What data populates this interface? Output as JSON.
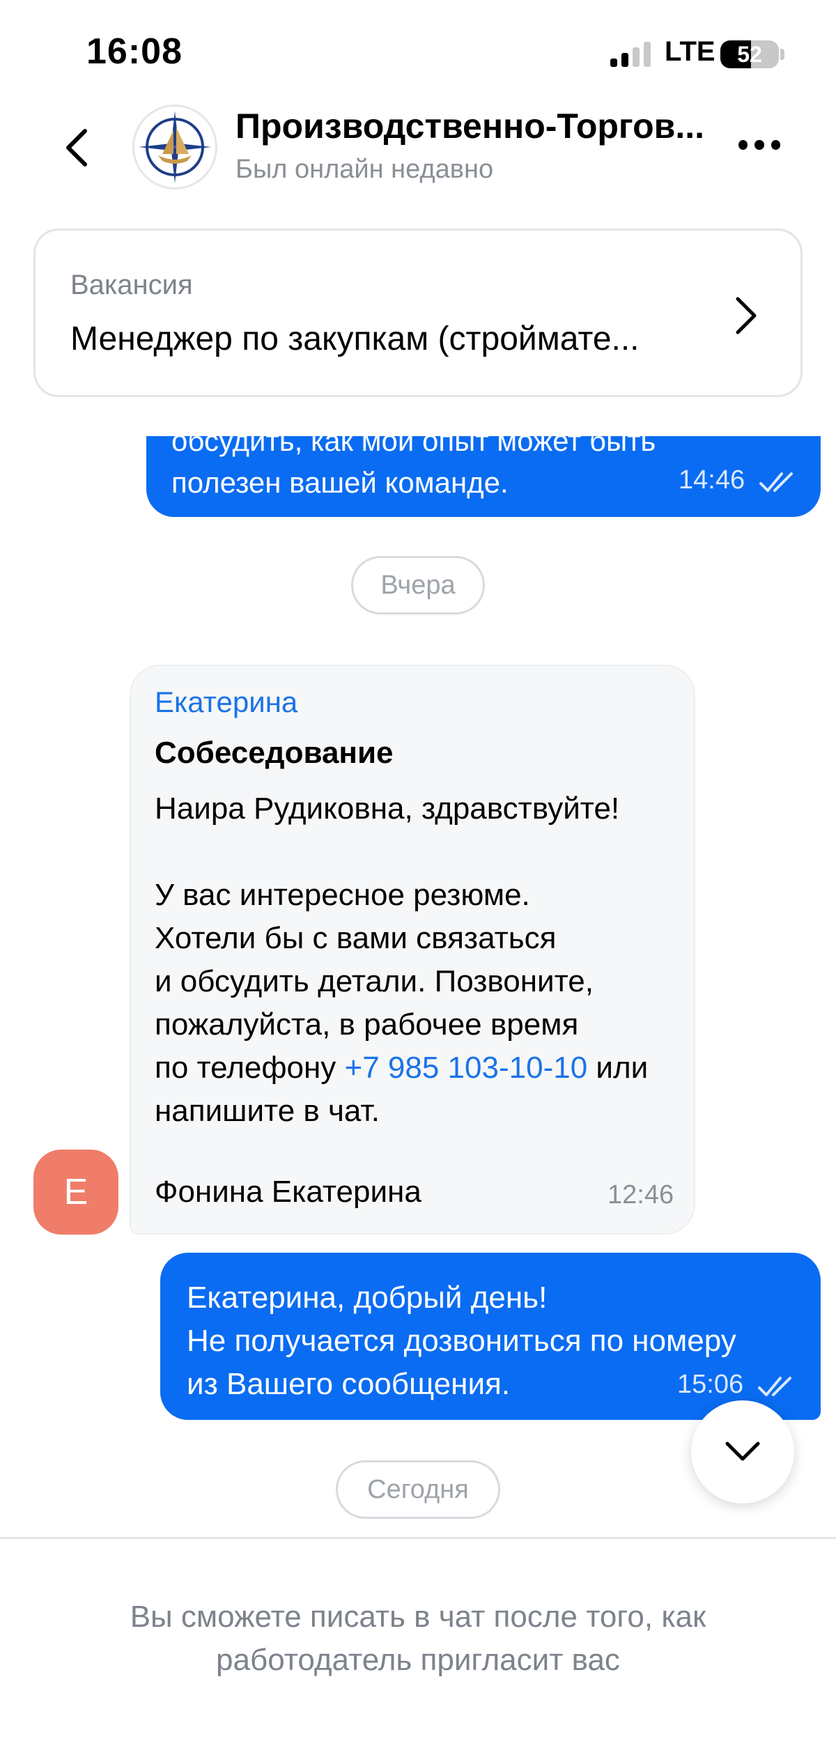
{
  "status_bar": {
    "time": "16:08",
    "network": "LTE",
    "battery": "52"
  },
  "header": {
    "title": "Производственно-Торгов...",
    "status": "Был онлайн недавно"
  },
  "vacancy": {
    "label": "Вакансия",
    "title": "Менеджер по закупкам (строймате..."
  },
  "messages": {
    "out_first": {
      "cut_line": "обсудить, как мой опыт может быть",
      "text": "полезен вашей команде.",
      "time": "14:46"
    },
    "date_yesterday": "Вчера",
    "incoming": {
      "sender": "Екатерина",
      "subject": "Собеседование",
      "body_before": "Наира Рудиковна, здравствуйте!\n\nУ вас интересное резюме.\nХотели бы с вами связаться\nи обсудить детали. Позвоните,\nпожалуйста, в рабочее время\nпо телефону ",
      "phone": "+7 985 103-10-10",
      "body_after": " или\nнапишите в чат.",
      "signature": "Фонина Екатерина",
      "time": "12:46",
      "avatar_letter": "Е"
    },
    "out_second": {
      "text": "Екатерина, добрый день!\nНе получается дозвониться по номеру\nиз Вашего сообщения.",
      "time": "15:06"
    },
    "date_today": "Сегодня"
  },
  "footer": {
    "note": "Вы сможете писать в чат после того, как\nработодатель пригласит вас"
  },
  "colors": {
    "accent": "#0a6cf2",
    "link": "#1a73e8",
    "avatar_e": "#f07d6a"
  },
  "icons": [
    "back-arrow-icon",
    "company-logo-icon",
    "more-icon",
    "chevron-right-icon",
    "double-check-icon",
    "chevron-down-icon"
  ]
}
